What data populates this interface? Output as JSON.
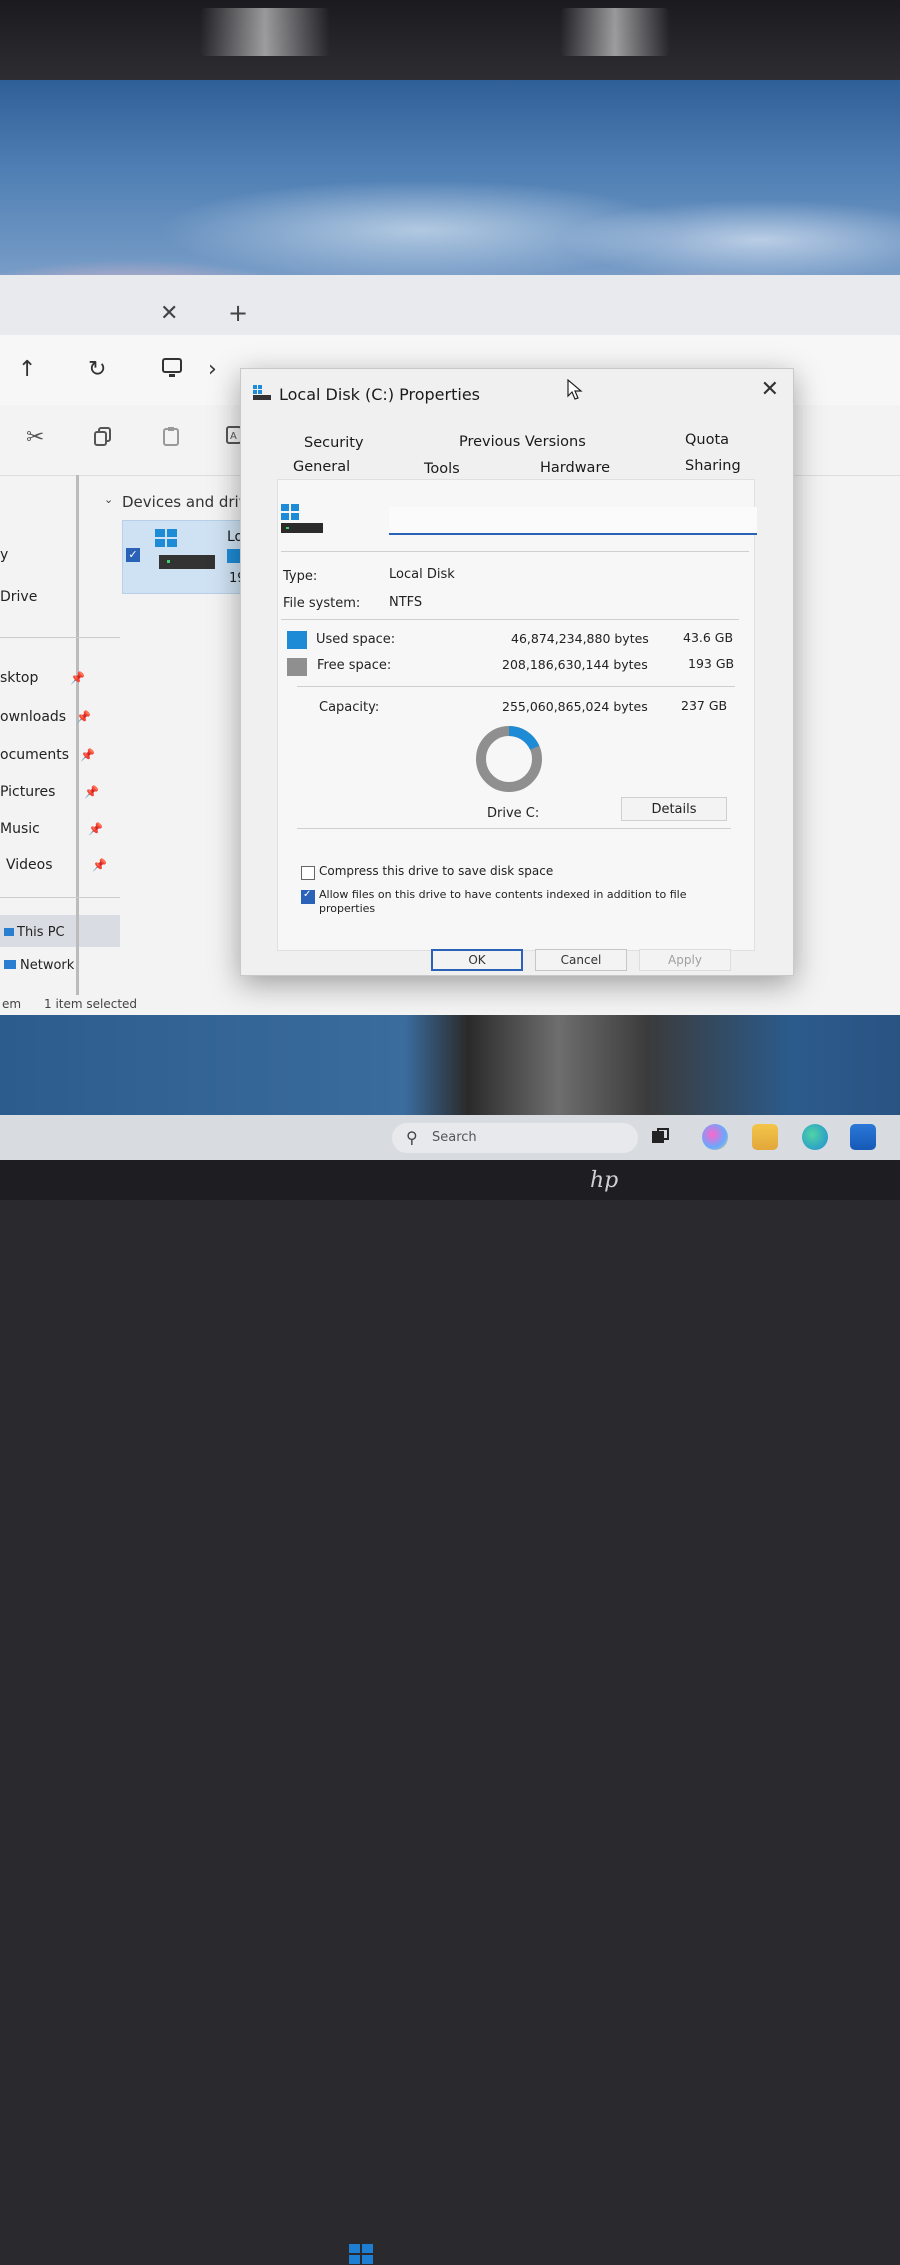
{
  "explorer": {
    "tab_close": "✕",
    "tab_add": "+",
    "nav": {
      "up": "↑",
      "refresh": "↻",
      "forward": "›"
    },
    "address_partial": "This PC",
    "group_header": "Devices and driv",
    "drive_tile": {
      "label_partial": "Loc",
      "size_partial": "19"
    },
    "sidebar": {
      "items": [
        {
          "label": "y"
        },
        {
          "label": "Drive"
        },
        {
          "label": "sktop",
          "pinned": true
        },
        {
          "label": "ownloads",
          "pinned": true
        },
        {
          "label": "ocuments",
          "pinned": true
        },
        {
          "label": "Pictures",
          "pinned": true
        },
        {
          "label": "Music",
          "pinned": true
        },
        {
          "label": "Videos",
          "pinned": true
        },
        {
          "label": "This PC",
          "selected": true
        },
        {
          "label": "Network"
        }
      ]
    },
    "status": {
      "items": "em",
      "selected": "1 item selected"
    }
  },
  "dialog": {
    "title": "Local Disk (C:) Properties",
    "close": "✕",
    "tabs_row1": [
      "Security",
      "Previous Versions",
      "Quota"
    ],
    "tabs_row2": [
      "General",
      "Tools",
      "Hardware",
      "Sharing"
    ],
    "active_tab": "General",
    "name_value": "",
    "type_label": "Type:",
    "type_value": "Local Disk",
    "fs_label": "File system:",
    "fs_value": "NTFS",
    "used_label": "Used space:",
    "used_bytes": "46,874,234,880 bytes",
    "used_gb": "43.6 GB",
    "free_label": "Free space:",
    "free_bytes": "208,186,630,144 bytes",
    "free_gb": "193 GB",
    "capacity_label": "Capacity:",
    "capacity_bytes": "255,060,865,024 bytes",
    "capacity_gb": "237 GB",
    "used_fraction": 0.184,
    "drive_label": "Drive C:",
    "details_button": "Details",
    "compress_label": "Compress this drive to save disk space",
    "compress_checked": false,
    "index_label": "Allow files on this drive to have contents indexed in addition to file properties",
    "index_checked": true,
    "ok_button": "OK",
    "cancel_button": "Cancel",
    "apply_button": "Apply"
  },
  "taskbar": {
    "search_placeholder": "Search"
  },
  "colors": {
    "used": "#1e8bd6",
    "free": "#8f8f8f",
    "accent": "#2a62b8"
  }
}
